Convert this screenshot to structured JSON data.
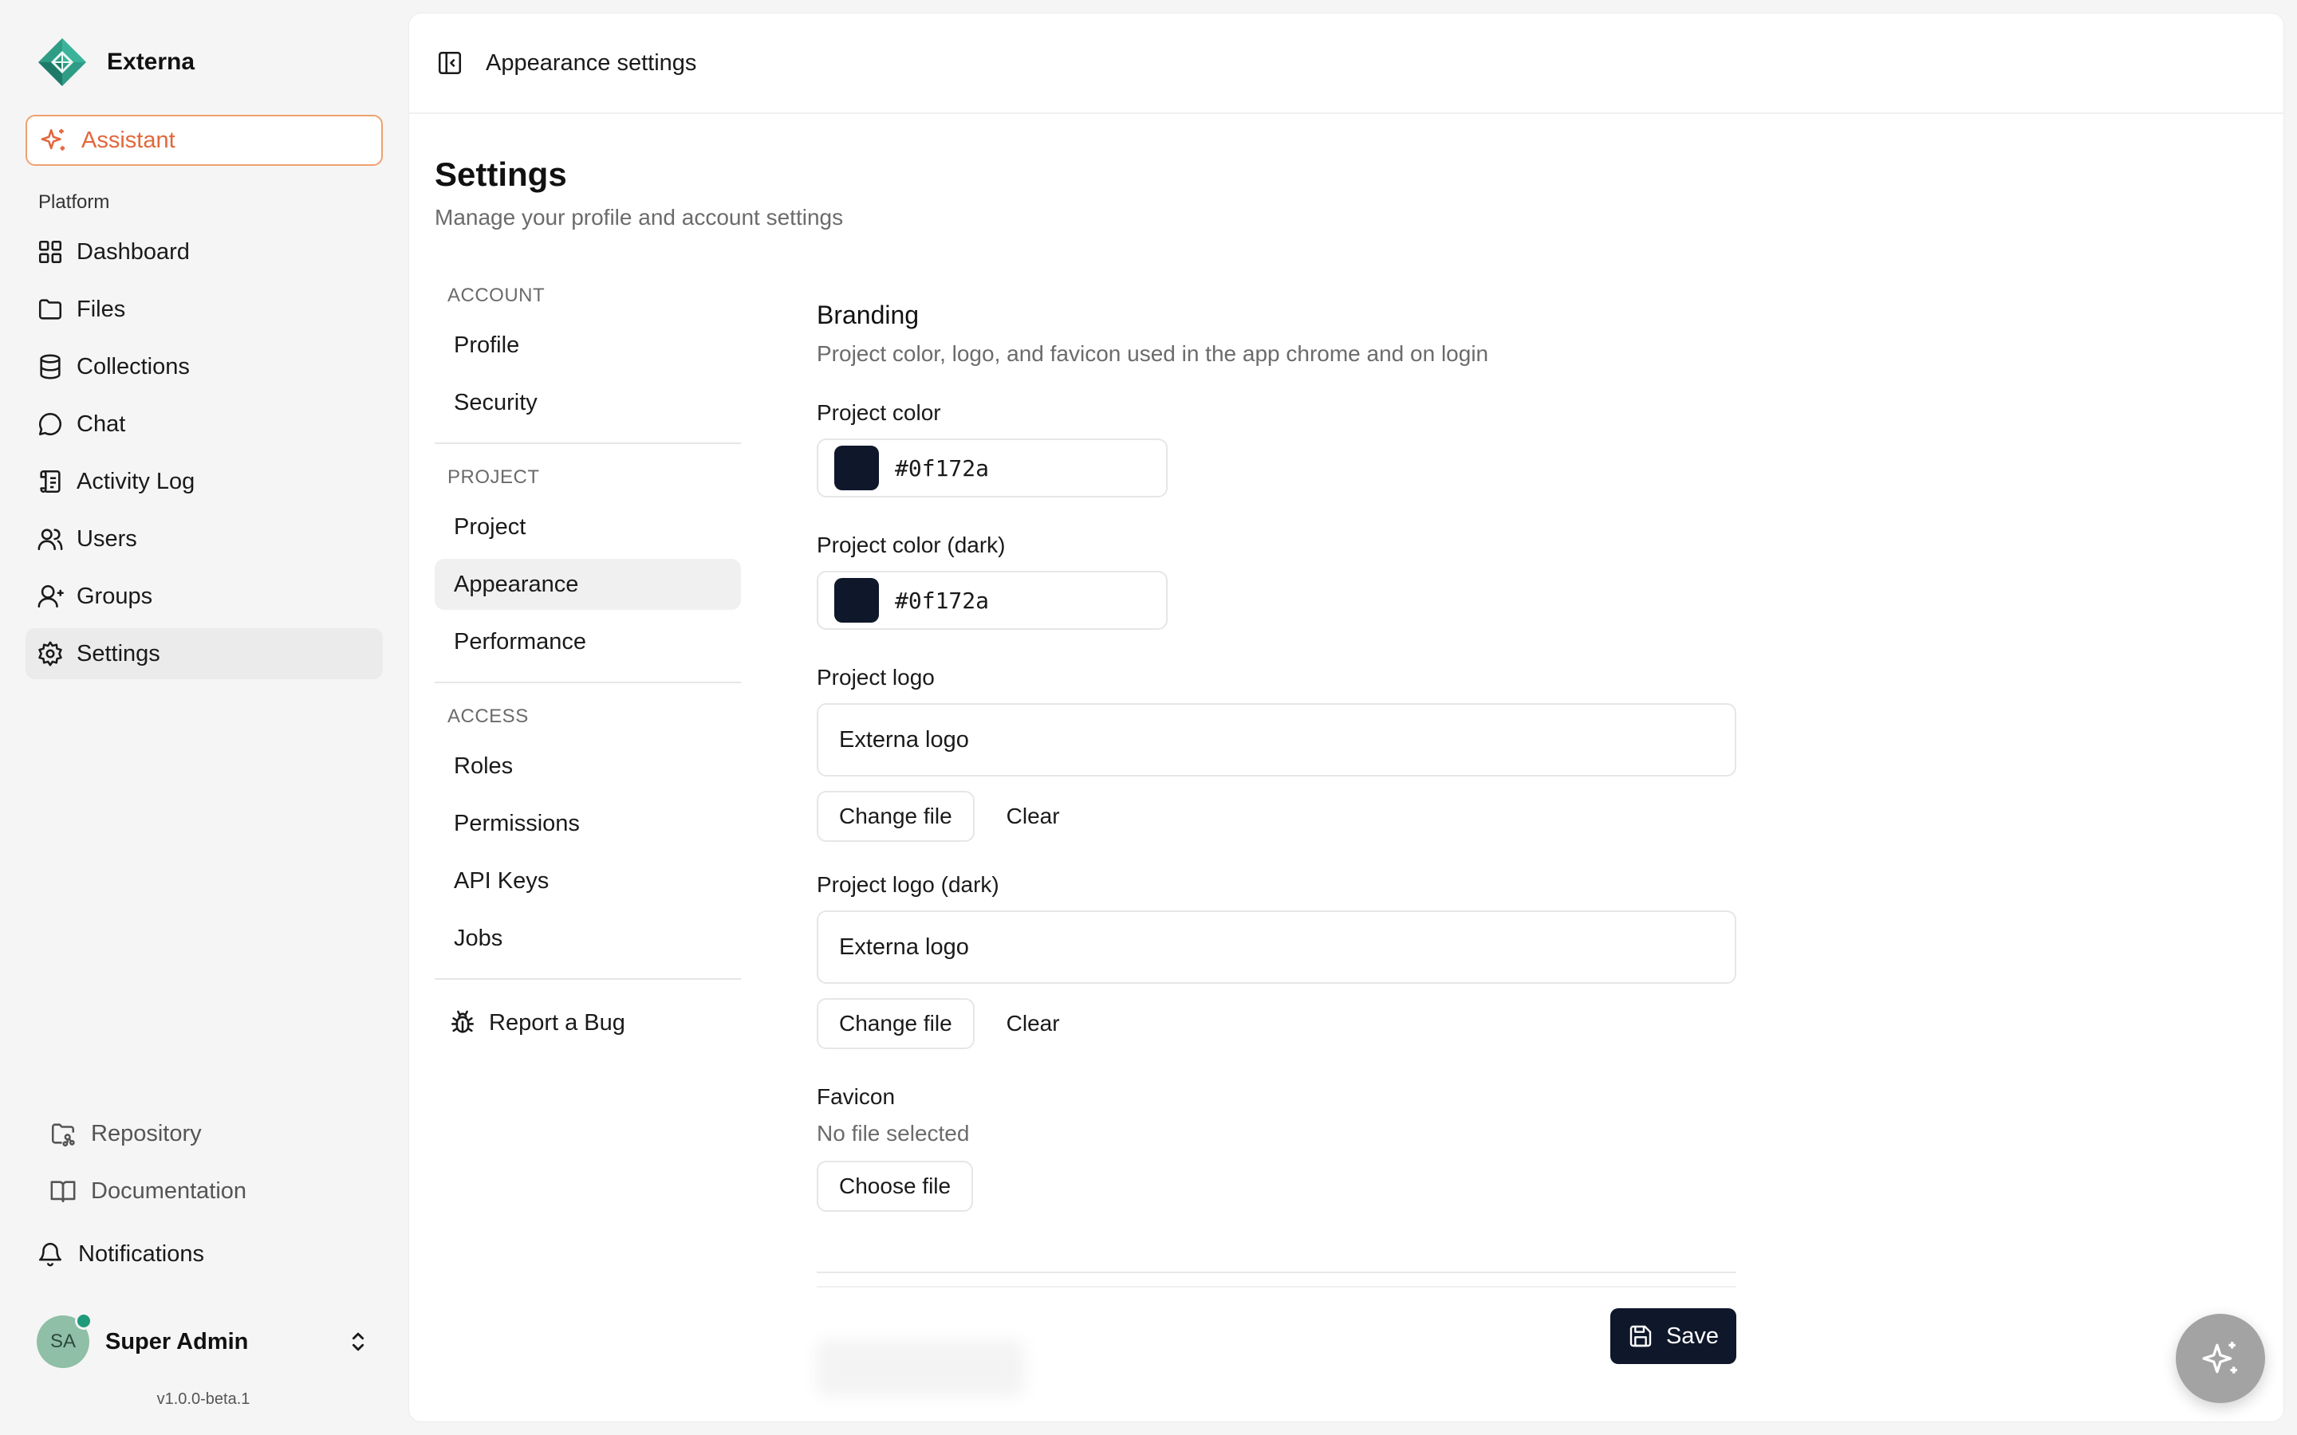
{
  "app": {
    "name": "Externa"
  },
  "sidebar": {
    "assistant_label": "Assistant",
    "section_label": "Platform",
    "items": [
      {
        "label": "Dashboard",
        "icon": "dashboard-icon"
      },
      {
        "label": "Files",
        "icon": "folder-icon"
      },
      {
        "label": "Collections",
        "icon": "database-icon"
      },
      {
        "label": "Chat",
        "icon": "chat-icon"
      },
      {
        "label": "Activity Log",
        "icon": "scroll-icon"
      },
      {
        "label": "Users",
        "icon": "users-icon"
      },
      {
        "label": "Groups",
        "icon": "groups-icon"
      },
      {
        "label": "Settings",
        "icon": "gear-icon"
      }
    ],
    "footer_links": [
      {
        "label": "Repository",
        "icon": "repository-icon"
      },
      {
        "label": "Documentation",
        "icon": "book-icon"
      }
    ],
    "notifications_label": "Notifications",
    "user": {
      "initials": "SA",
      "name": "Super Admin"
    },
    "version": "v1.0.0-beta.1"
  },
  "header": {
    "breadcrumb": "Appearance settings"
  },
  "page": {
    "title": "Settings",
    "subtitle": "Manage your profile and account settings"
  },
  "subnav": {
    "account_heading": "ACCOUNT",
    "account_items": [
      "Profile",
      "Security"
    ],
    "project_heading": "PROJECT",
    "project_items": [
      "Project",
      "Appearance",
      "Performance"
    ],
    "access_heading": "ACCESS",
    "access_items": [
      "Roles",
      "Permissions",
      "API Keys",
      "Jobs"
    ],
    "report_bug": "Report a Bug"
  },
  "branding": {
    "title": "Branding",
    "subtitle": "Project color, logo, and favicon used in the app chrome and on login",
    "color": {
      "label": "Project color",
      "value": "#0f172a"
    },
    "color_dark": {
      "label": "Project color (dark)",
      "value": "#0f172a"
    },
    "logo": {
      "label": "Project logo",
      "value": "Externa logo",
      "change": "Change file",
      "clear": "Clear"
    },
    "logo_dark": {
      "label": "Project logo (dark)",
      "value": "Externa logo",
      "change": "Change file",
      "clear": "Clear"
    },
    "favicon": {
      "label": "Favicon",
      "status": "No file selected",
      "choose": "Choose file"
    }
  },
  "actions": {
    "save_label": "Save"
  },
  "colors": {
    "accent": "#e2673b",
    "primary": "#0f172a",
    "brand_green": "#1f9a7a"
  }
}
